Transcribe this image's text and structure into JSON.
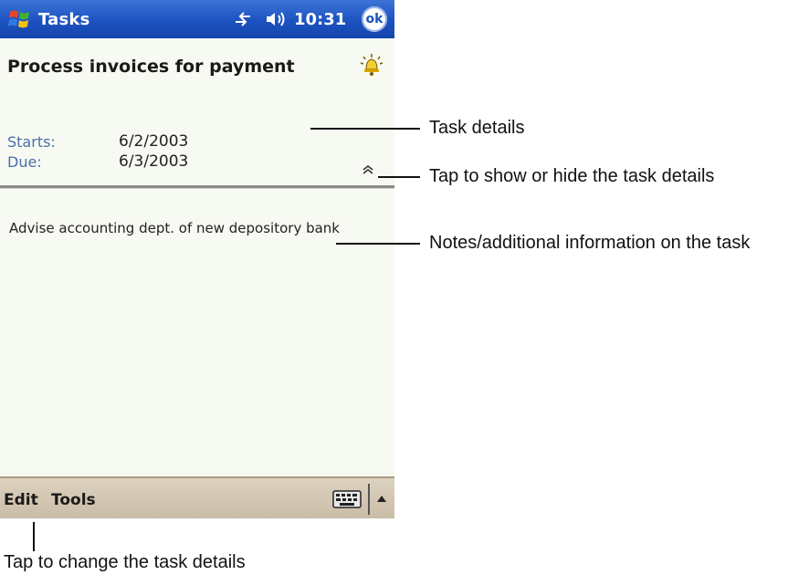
{
  "titlebar": {
    "app_title": "Tasks",
    "clock": "10:31",
    "ok_label": "ok"
  },
  "task": {
    "title": "Process invoices for payment",
    "starts_label": "Starts:",
    "starts_value": "6/2/2003",
    "due_label": "Due:",
    "due_value": "6/3/2003",
    "notes": "Advise accounting dept. of new depository bank"
  },
  "menubar": {
    "edit_label": "Edit",
    "tools_label": "Tools"
  },
  "callouts": {
    "task_details": "Task details",
    "toggle_details": "Tap to show or hide the task details",
    "notes": "Notes/additional information on the task",
    "edit": "Tap to change the task details"
  },
  "icons": {
    "start": "windows-flag-icon",
    "connectivity": "connectivity-icon",
    "volume": "speaker-icon",
    "reminder": "alarm-bell-icon",
    "toggle": "double-chevron-up-icon",
    "keyboard": "keyboard-icon",
    "sip_arrow": "triangle-up-icon"
  },
  "colors": {
    "titlebar": "#1c52c0",
    "label": "#4a6fa8",
    "menubar": "#d4c8b4"
  }
}
